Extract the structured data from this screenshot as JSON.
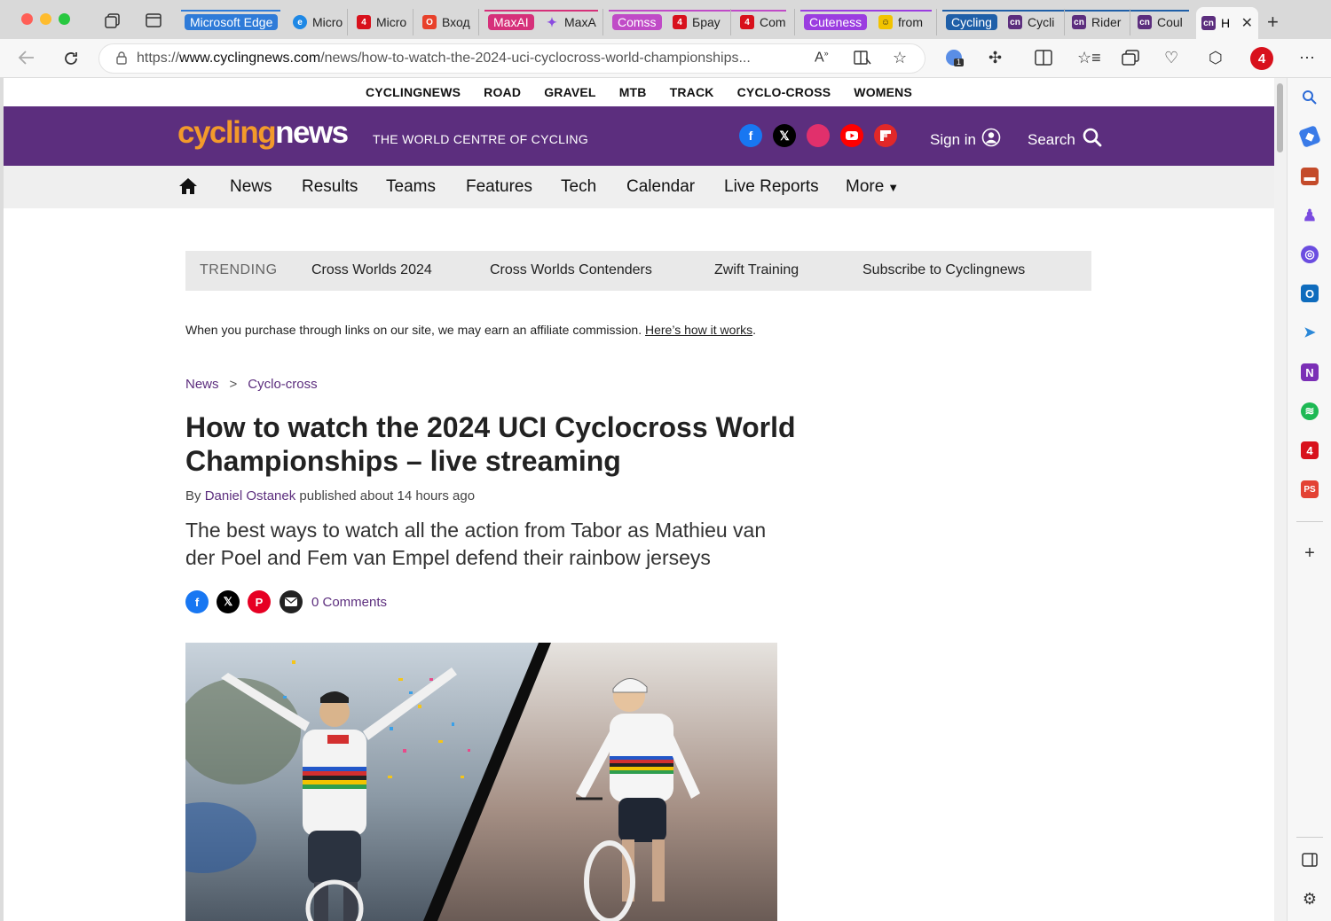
{
  "browser": {
    "tabs": [
      {
        "label": "Microsoft Edge",
        "group_color": "#2f7bd8"
      },
      {
        "label": "Micro"
      },
      {
        "label": "Micro"
      },
      {
        "label": "Вход"
      },
      {
        "label": "MaxAI",
        "group_color": "#d6307a"
      },
      {
        "label": "MaxA"
      },
      {
        "label": "Comss",
        "group_color": "#c04bc7"
      },
      {
        "label": "Брау"
      },
      {
        "label": "Com"
      },
      {
        "label": "Cuteness",
        "group_color": "#9b3de0"
      },
      {
        "label": "from"
      },
      {
        "label": "Cycling",
        "group_color": "#1f5fa8"
      },
      {
        "label": "Cycli"
      },
      {
        "label": "Rider"
      },
      {
        "label": "Coul"
      },
      {
        "label": "H"
      }
    ],
    "url_prefix": "https://",
    "url_domain": "www.cyclingnews.com",
    "url_path": "/news/how-to-watch-the-2024-uci-cyclocross-world-championships...",
    "badge_count": "1"
  },
  "topnav": [
    "CYCLINGNEWS",
    "ROAD",
    "GRAVEL",
    "MTB",
    "TRACK",
    "CYCLO-CROSS",
    "WOMENS"
  ],
  "header": {
    "logo_part1": "cycling",
    "logo_part2": "news",
    "tagline": "THE WORLD CENTRE OF CYCLING",
    "sign_in": "Sign in",
    "search": "Search",
    "brand_color": "#5c2e7e",
    "logo_color": "#f39a2b"
  },
  "mainnav": [
    "News",
    "Results",
    "Teams",
    "Features",
    "Tech",
    "Calendar",
    "Live Reports",
    "More"
  ],
  "trending": {
    "label": "TRENDING",
    "items": [
      "Cross Worlds 2024",
      "Cross Worlds Contenders",
      "Zwift Training",
      "Subscribe to Cyclingnews"
    ]
  },
  "affiliate": {
    "text": "When you purchase through links on our site, we may earn an affiliate commission. ",
    "link": "Here’s how it works",
    "tail": "."
  },
  "breadcrumb": {
    "level1": "News",
    "separator": ">",
    "level2": "Cyclo-cross"
  },
  "article": {
    "title": "How to watch the 2024 UCI Cyclocross World Championships – live streaming",
    "by": "By ",
    "author": "Daniel Ostanek",
    "published": " published about 14 hours ago",
    "standfirst": "The best ways to watch all the action from Tabor as Mathieu van der Poel and Fem van Empel defend their rainbow jerseys",
    "comments": "0 Comments"
  }
}
